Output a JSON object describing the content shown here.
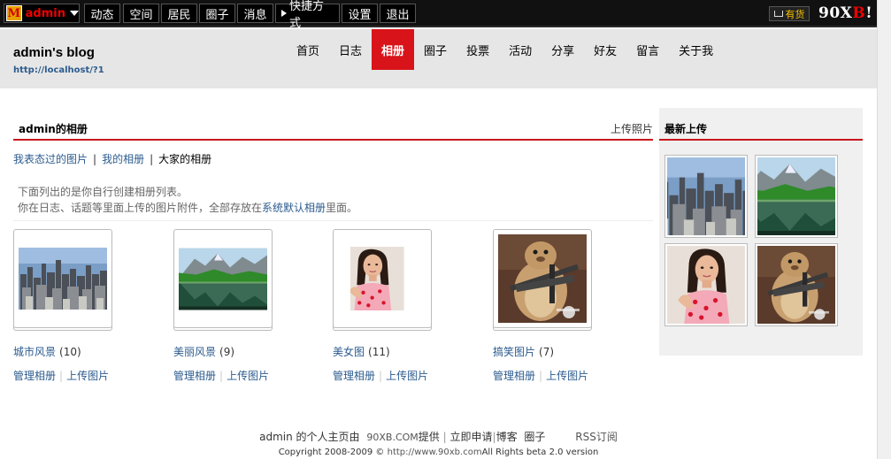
{
  "topbar": {
    "user": "admin",
    "menu": [
      {
        "label": "动态"
      },
      {
        "label": "空间"
      },
      {
        "label": "居民"
      },
      {
        "label": "圈子"
      },
      {
        "label": "消息"
      },
      {
        "label": "快捷方式"
      },
      {
        "label": "设置"
      },
      {
        "label": "退出"
      }
    ],
    "shop_label": "有货",
    "brand_prefix": "90X",
    "brand_accent": "B",
    "brand_suffix": "!"
  },
  "header": {
    "blog_title": "admin's blog",
    "blog_url": "http://localhost/?1",
    "nav": [
      {
        "label": "首页"
      },
      {
        "label": "日志"
      },
      {
        "label": "相册",
        "active": true
      },
      {
        "label": "圈子"
      },
      {
        "label": "投票"
      },
      {
        "label": "活动"
      },
      {
        "label": "分享"
      },
      {
        "label": "好友"
      },
      {
        "label": "留言"
      },
      {
        "label": "关于我"
      }
    ]
  },
  "main": {
    "section_title": "admin的相册",
    "upload_link": "上传照片",
    "tabs": [
      "我表态过的图片",
      "我的相册",
      "大家的相册"
    ],
    "tab_separator": "|",
    "desc_line1": "下面列出的是你自行创建相册列表。",
    "desc_line2_before": "你在日志、话题等里面上传的图片附件，全部存放在",
    "desc_line2_link": "系统默认相册",
    "desc_line2_after": "里面。",
    "albums": [
      {
        "name": "城市风景",
        "count": "(10)",
        "manage": "管理相册",
        "upload": "上传图片"
      },
      {
        "name": "美丽风景",
        "count": "(9)",
        "manage": "管理相册",
        "upload": "上传图片"
      },
      {
        "name": "美女图",
        "count": "(11)",
        "manage": "管理相册",
        "upload": "上传图片"
      },
      {
        "name": "搞笑图片",
        "count": "(7)",
        "manage": "管理相册",
        "upload": "上传图片"
      }
    ]
  },
  "sidebar": {
    "title": "最新上传"
  },
  "footer": {
    "site_name": "admin 的个人主页由",
    "provider": "90XB.COM",
    "provided": "提供",
    "links": [
      "立即申请",
      "博客",
      "圈子"
    ],
    "rss": "RSS订阅",
    "copyright_prefix": "Copyright 2008-2009 ©",
    "copyright_url": "http://www.90xb.com",
    "copyright_suffix": "All Rights beta 2.0 version"
  },
  "colors": {
    "accent_red": "#d8141a",
    "link_blue": "#2b5b8e",
    "topbar_bg": "#111111",
    "header_bg": "#e6e6e6"
  }
}
